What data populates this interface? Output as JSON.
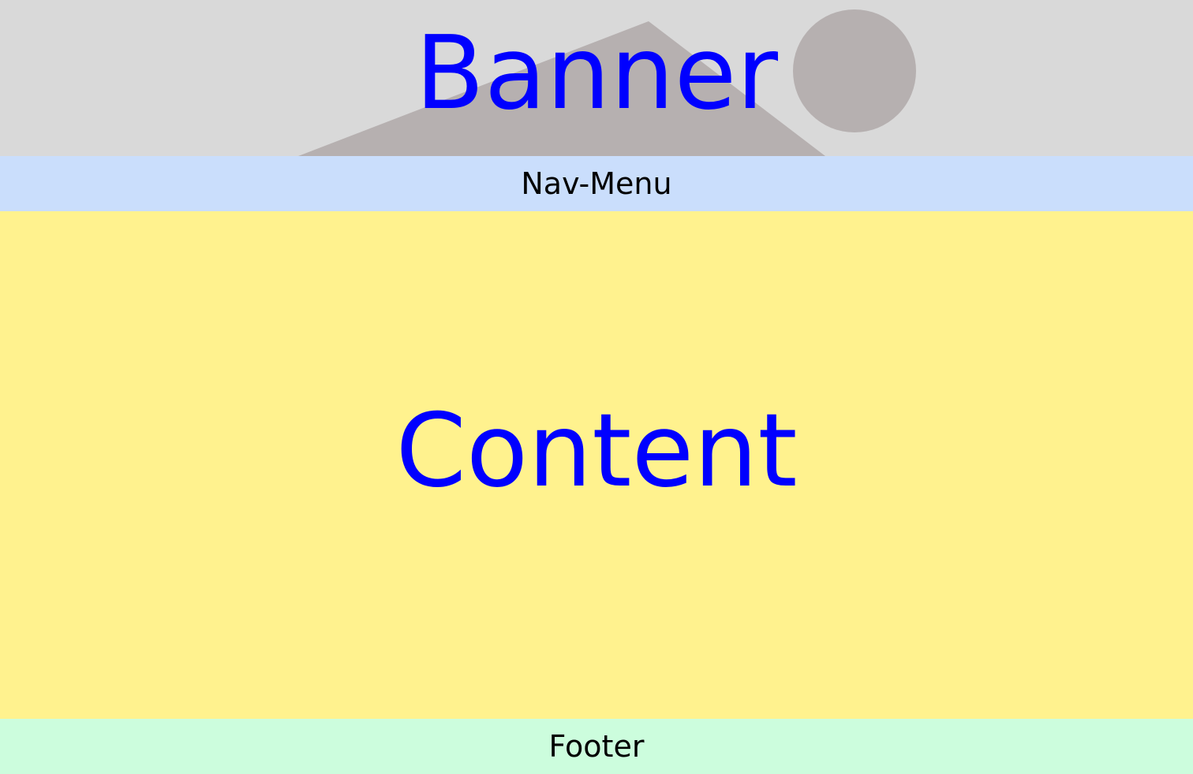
{
  "banner": {
    "title": "Banner",
    "background_color": "#d9d9d9",
    "illustration_color": "#b6b0b0",
    "title_color": "#0000ff",
    "illustration": "landscape-placeholder-image"
  },
  "nav": {
    "label": "Nav-Menu",
    "background_color": "#cadefc"
  },
  "content": {
    "label": "Content",
    "background_color": "#fff28e",
    "text_color": "#0000ff"
  },
  "footer": {
    "label": "Footer",
    "background_color": "#ccfddd"
  }
}
